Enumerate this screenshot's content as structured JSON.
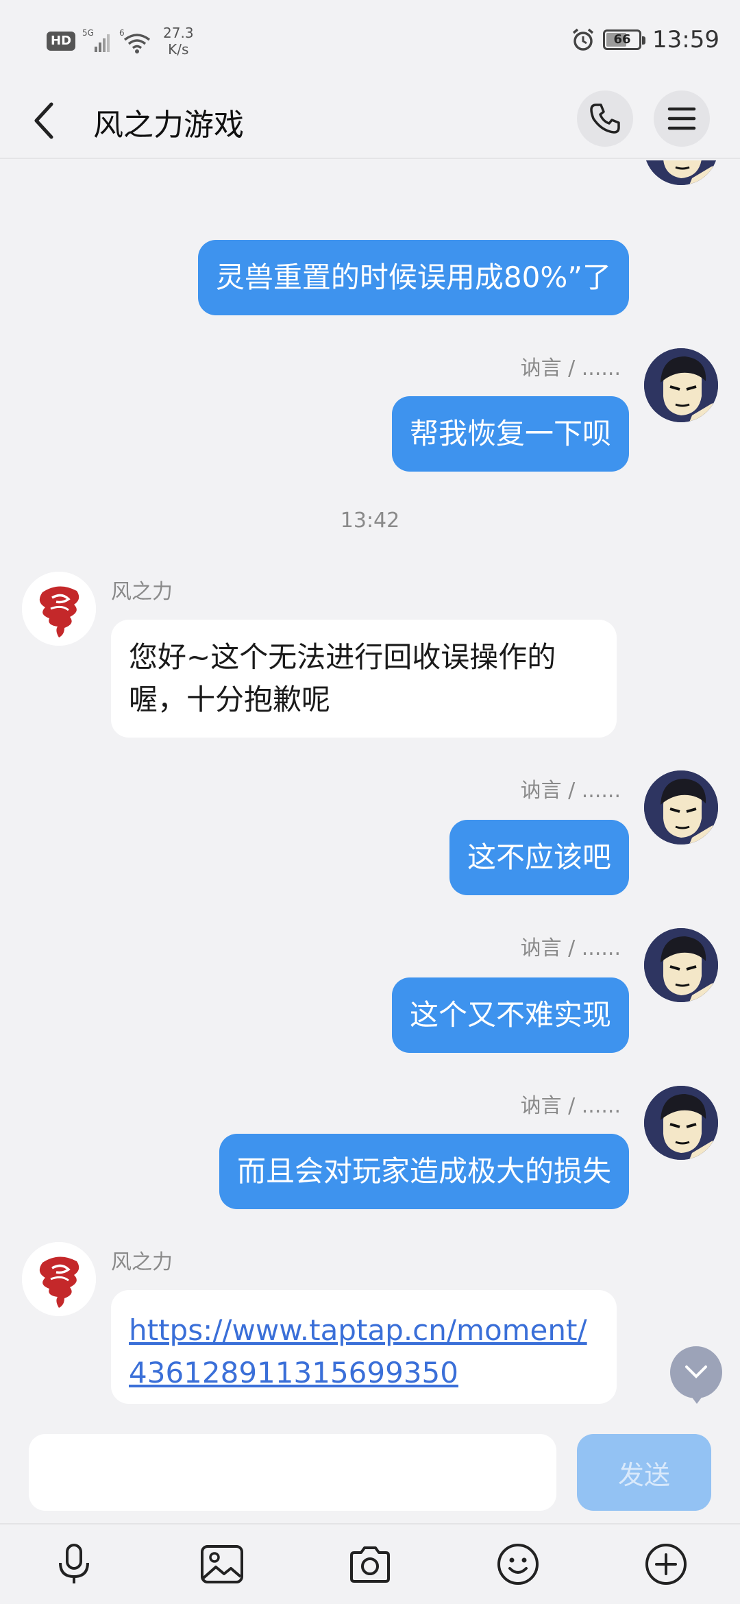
{
  "status_bar": {
    "hd": "HD",
    "net_speed_value": "27.3",
    "net_speed_unit": "K/s",
    "battery": "66",
    "battery_level_percent": 66,
    "time": "13:59"
  },
  "header": {
    "title": "风之力游戏",
    "icons": [
      "back-arrow-icon",
      "phone-icon",
      "menu-icon"
    ]
  },
  "chat": {
    "messages": [
      {
        "direction": "out",
        "text": "灵兽重置的时候误用成80%”了"
      },
      {
        "direction": "out",
        "sender": "讷言 / ......",
        "text": "帮我恢复一下呗"
      },
      {
        "type": "time",
        "text": "13:42"
      },
      {
        "direction": "in",
        "sender": "风之力",
        "text": "您好~这个无法进行回收误操作的喔，十分抱歉呢"
      },
      {
        "direction": "out",
        "sender": "讷言 / ......",
        "text": "这不应该吧"
      },
      {
        "direction": "out",
        "sender": "讷言 / ......",
        "text": "这个又不难实现"
      },
      {
        "direction": "out",
        "sender": "讷言 / ......",
        "text": "而且会对玩家造成极大的损失"
      },
      {
        "direction": "in",
        "sender": "风之力",
        "text": "https://www.taptap.cn/moment/436128911315699350",
        "is_link": true
      }
    ]
  },
  "input": {
    "value": "",
    "send_label": "发送"
  },
  "toolbar": {
    "icons": [
      "microphone-icon",
      "image-icon",
      "camera-icon",
      "emoji-icon",
      "add-icon"
    ]
  },
  "colors": {
    "outgoing_bubble": "#3e93ee",
    "incoming_bubble": "#ffffff",
    "background": "#f2f2f4",
    "send_button": "#93c2f3",
    "link": "#3a6fd8"
  }
}
